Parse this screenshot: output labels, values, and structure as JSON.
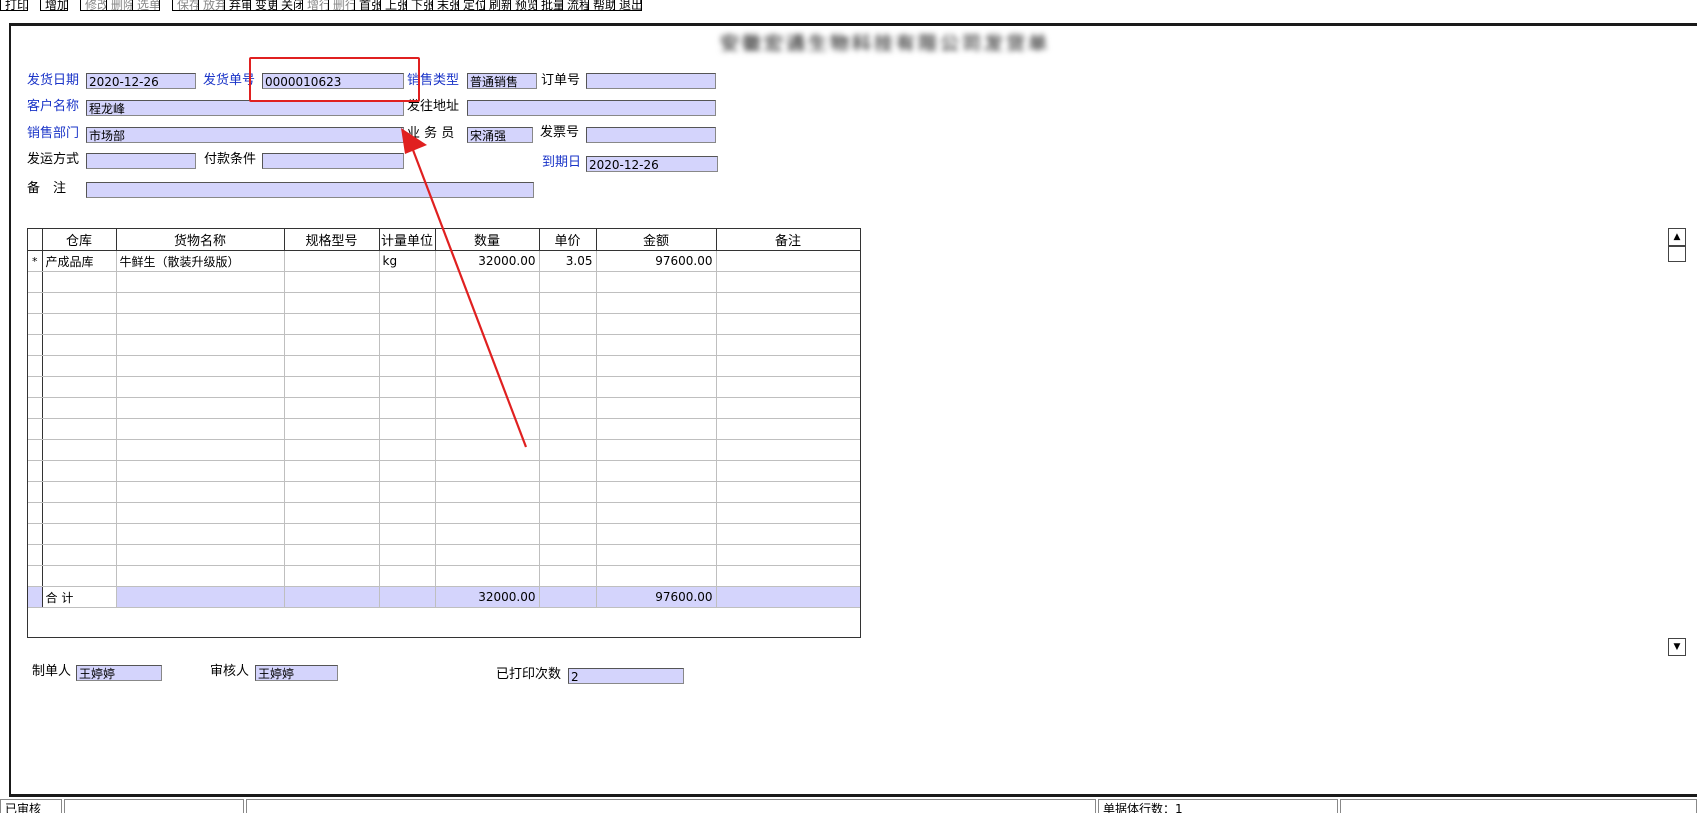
{
  "toolbar": {
    "items": [
      {
        "label": "打印",
        "enabled": true
      },
      {
        "label": "增加",
        "enabled": true
      },
      {
        "label": "修改",
        "enabled": false
      },
      {
        "label": "删除",
        "enabled": false
      },
      {
        "label": "选单",
        "enabled": false
      },
      {
        "label": "保存",
        "enabled": false
      },
      {
        "label": "放弃",
        "enabled": false
      },
      {
        "label": "弃审",
        "enabled": true
      },
      {
        "label": "变更",
        "enabled": true
      },
      {
        "label": "关闭",
        "enabled": true
      },
      {
        "label": "增行",
        "enabled": false
      },
      {
        "label": "删行",
        "enabled": false
      },
      {
        "label": "首张",
        "enabled": true
      },
      {
        "label": "上张",
        "enabled": true
      },
      {
        "label": "下张",
        "enabled": true
      },
      {
        "label": "末张",
        "enabled": true
      },
      {
        "label": "定位",
        "enabled": true
      },
      {
        "label": "刷新",
        "enabled": true
      },
      {
        "label": "预览",
        "enabled": true
      },
      {
        "label": "批量",
        "enabled": true
      },
      {
        "label": "流程",
        "enabled": true
      },
      {
        "label": "帮助",
        "enabled": true
      },
      {
        "label": "退出",
        "enabled": true
      }
    ]
  },
  "header": {
    "company_title": "安徽宏通生物科技有限公司发货单"
  },
  "form": {
    "ship_date": {
      "label": "发货日期",
      "value": "2020-12-26"
    },
    "ship_no": {
      "label": "发货单号",
      "value": "0000010623"
    },
    "sale_type": {
      "label": "销售类型",
      "value": "普通销售"
    },
    "order_no": {
      "label": "订单号",
      "value": ""
    },
    "customer": {
      "label": "客户名称",
      "value": "程龙峰"
    },
    "ship_address": {
      "label": "发往地址",
      "value": ""
    },
    "dept": {
      "label": "销售部门",
      "value": "市场部"
    },
    "salesman": {
      "label": "业 务 员",
      "value": "宋涌强"
    },
    "invoice_no": {
      "label": "发票号",
      "value": ""
    },
    "ship_method": {
      "label": "发运方式",
      "value": ""
    },
    "pay_terms": {
      "label": "付款条件",
      "value": ""
    },
    "due_date": {
      "label": "到期日",
      "value": "2020-12-26"
    },
    "remark": {
      "label": "备　注",
      "value": ""
    }
  },
  "grid": {
    "columns": [
      "仓库",
      "货物名称",
      "规格型号",
      "计量单位",
      "数量",
      "单价",
      "金额",
      "备注"
    ],
    "rows": [
      {
        "marker": "*",
        "warehouse": "产成品库",
        "goods": "牛鲜生（散装升级版）",
        "spec": "",
        "unit": "kg",
        "qty": "32000.00",
        "price": "3.05",
        "amount": "97600.00",
        "note": ""
      }
    ],
    "total": {
      "label": "合 计",
      "qty": "32000.00",
      "amount": "97600.00"
    }
  },
  "footer": {
    "maker": {
      "label": "制单人",
      "value": "王婷婷"
    },
    "auditor": {
      "label": "审核人",
      "value": "王婷婷"
    },
    "print_count": {
      "label": "已打印次数",
      "value": "2"
    }
  },
  "statusbar": {
    "status": "已审核",
    "row_count": "单据体行数：1"
  },
  "colors": {
    "field_bg": "#d4d4fc",
    "required_label": "#1a34c8",
    "annotation": "#e02020"
  }
}
